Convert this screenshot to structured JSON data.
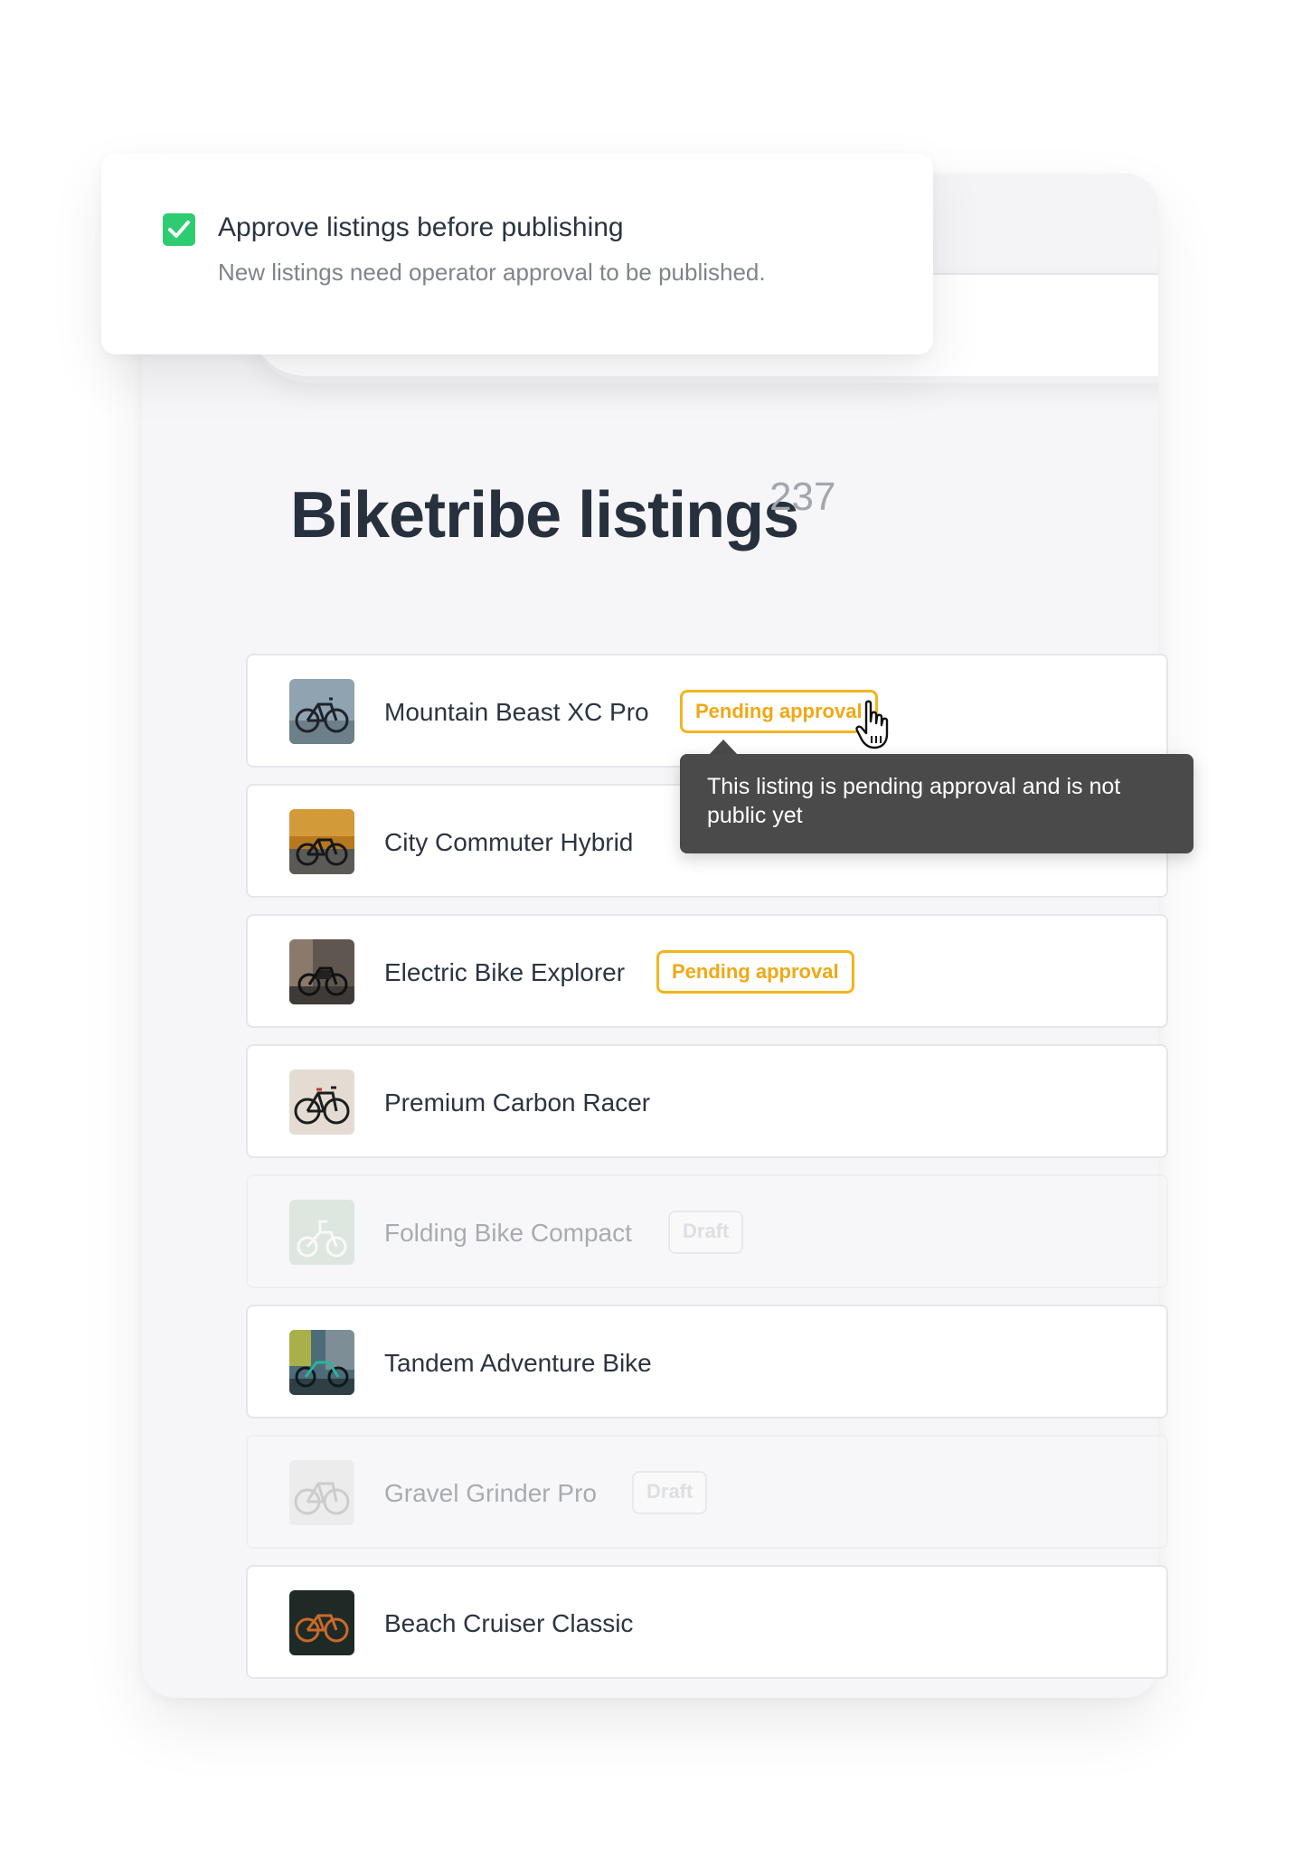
{
  "approval_setting": {
    "checked": true,
    "label": "Approve listings before publishing",
    "description": "New listings need operator approval to be published."
  },
  "page": {
    "title": "Biketribe listings",
    "count": "237"
  },
  "listings": [
    {
      "name": "Mountain Beast XC Pro",
      "badge": "Pending approval",
      "status": "pending",
      "thumbnail_icon": "bicycle-photo"
    },
    {
      "name": "City Commuter Hybrid",
      "badge": "",
      "status": "published",
      "thumbnail_icon": "bicycle-photo"
    },
    {
      "name": "Electric Bike Explorer",
      "badge": "Pending approval",
      "status": "pending",
      "thumbnail_icon": "bicycle-photo"
    },
    {
      "name": "Premium Carbon Racer",
      "badge": "",
      "status": "published",
      "thumbnail_icon": "bicycle-photo"
    },
    {
      "name": "Folding Bike Compact",
      "badge": "Draft",
      "status": "draft",
      "thumbnail_icon": "bicycle-photo"
    },
    {
      "name": "Tandem Adventure Bike",
      "badge": "",
      "status": "published",
      "thumbnail_icon": "bicycle-photo"
    },
    {
      "name": "Gravel Grinder Pro",
      "badge": "Draft",
      "status": "draft",
      "thumbnail_icon": "bicycle-photo"
    },
    {
      "name": "Beach Cruiser Classic",
      "badge": "",
      "status": "published",
      "thumbnail_icon": "bicycle-photo"
    }
  ],
  "tooltip": {
    "line1": "This listing is pending approval and is not",
    "line2": "public yet"
  },
  "colors": {
    "accent_pending": "#f4b41d",
    "checkbox_green": "#2ecc71",
    "tooltip_bg": "#4a4a4a",
    "title_text": "#27303d"
  }
}
